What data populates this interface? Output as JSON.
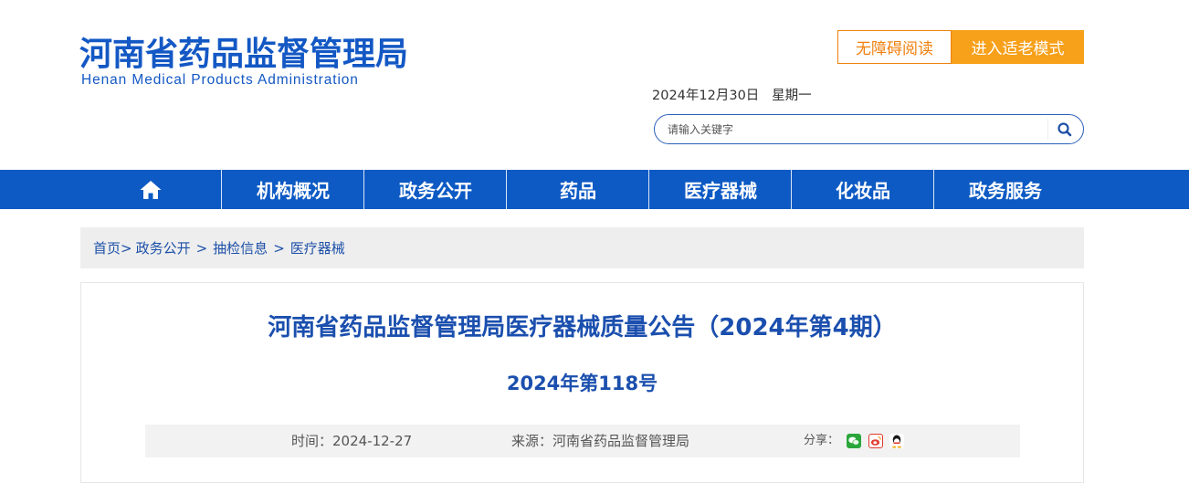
{
  "header": {
    "logo_cn": "河南省药品监督管理局",
    "logo_en": "Henan Medical Products Administration",
    "accessibility_label": "无障碍阅读",
    "elder_mode_label": "进入适老模式",
    "date": "2024年12月30日   星期一",
    "search_placeholder": "请输入关键字"
  },
  "nav": {
    "items": [
      "机构概况",
      "政务公开",
      "药品",
      "医疗器械",
      "化妆品",
      "政务服务"
    ]
  },
  "breadcrumb": {
    "items": [
      "首页>",
      "政务公开",
      "抽检信息",
      "医疗器械"
    ],
    "separator": ">"
  },
  "article": {
    "title": "河南省药品监督管理局医疗器械质量公告（2024年第4期）",
    "doc_no": "2024年第118号",
    "time": "时间：2024-12-27",
    "source": "来源：河南省药品监督管理局",
    "share_label": "分享："
  },
  "colors": {
    "brand_blue": "#0d5ac4",
    "accent_orange": "#f7a01a"
  }
}
